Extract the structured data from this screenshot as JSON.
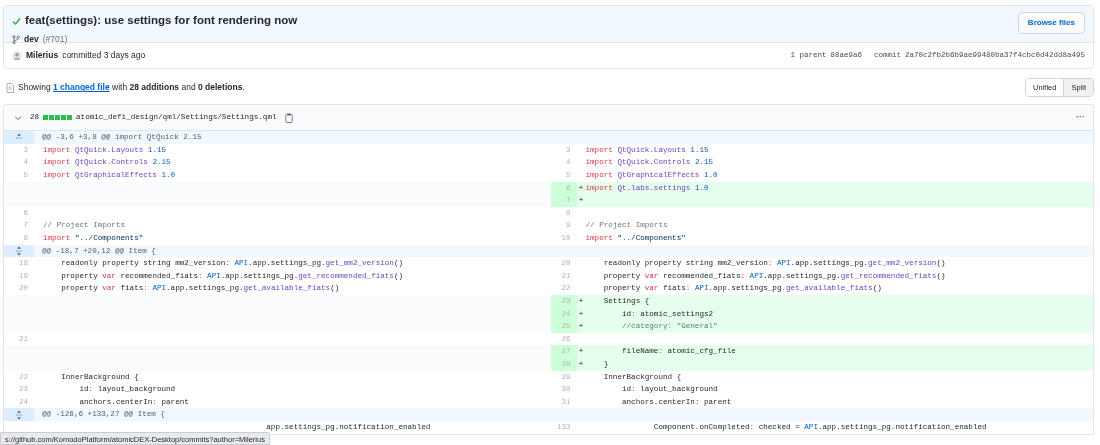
{
  "commit": {
    "title": "feat(settings): use settings for font rendering now",
    "verified": true,
    "branch": "dev",
    "pr": "(#701)",
    "browse_button": "Browse files",
    "author": "Milerius",
    "committed": "committed 3 days ago",
    "parent_label": "1 parent",
    "parent_sha": "88ae9a6",
    "commit_label": "commit",
    "commit_sha": "2a70c2fb2b6b9ae99480ba37f4cbc0d42dd8a495"
  },
  "summary": {
    "before": "Showing",
    "link": "1 changed file",
    "after": "with **28 additions** and **0 deletions**."
  },
  "view_toggle": [
    {
      "label": "Unified",
      "selected": false
    },
    {
      "label": "Split",
      "selected": true
    }
  ],
  "file": {
    "changes": "28",
    "path": "atomic_defi_design/qml/Settings/Settings.qml",
    "more": "···"
  },
  "rows": [
    {
      "kind": "hunk",
      "expand_up": true,
      "expand_down": false,
      "text": "@@ -3,6 +3,8 @@ import QtQuick 2.15"
    },
    {
      "kind": "line",
      "left": {
        "kind": "context",
        "number": "3",
        "tokens": [
          {
            "kind": "keyword",
            "text": "import"
          },
          {
            "kind": "type",
            "text": " QtQuick.Layouts"
          },
          {
            "kind": "number",
            "text": " 1.15"
          }
        ]
      },
      "right": {
        "kind": "context",
        "number": "3",
        "tokens": [
          {
            "kind": "keyword",
            "text": "import"
          },
          {
            "kind": "type",
            "text": " QtQuick.Layouts"
          },
          {
            "kind": "number",
            "text": " 1.15"
          }
        ]
      }
    },
    {
      "kind": "line",
      "left": {
        "kind": "context",
        "number": "4",
        "tokens": [
          {
            "kind": "keyword",
            "text": "import"
          },
          {
            "kind": "type",
            "text": " QtQuick.Controls"
          },
          {
            "kind": "number",
            "text": " 2.15"
          }
        ]
      },
      "right": {
        "kind": "context",
        "number": "4",
        "tokens": [
          {
            "kind": "keyword",
            "text": "import"
          },
          {
            "kind": "type",
            "text": " QtQuick.Controls"
          },
          {
            "kind": "number",
            "text": " 2.15"
          }
        ]
      }
    },
    {
      "kind": "line",
      "left": {
        "kind": "context",
        "number": "5",
        "tokens": [
          {
            "kind": "keyword",
            "text": "import"
          },
          {
            "kind": "type",
            "text": " QtGraphicalEffects"
          },
          {
            "kind": "number",
            "text": " 1.0"
          }
        ]
      },
      "right": {
        "kind": "context",
        "number": "5",
        "tokens": [
          {
            "kind": "keyword",
            "text": "import"
          },
          {
            "kind": "type",
            "text": " QtGraphicalEffects"
          },
          {
            "kind": "number",
            "text": " 1.0"
          }
        ]
      }
    },
    {
      "kind": "line",
      "left": {
        "kind": "empty"
      },
      "right": {
        "kind": "added",
        "number": "6",
        "sign": "+",
        "tokens": [
          {
            "kind": "keyword",
            "text": "import"
          },
          {
            "kind": "type",
            "text": " Qt.labs.settings"
          },
          {
            "kind": "number",
            "text": " 1.0"
          }
        ]
      }
    },
    {
      "kind": "line",
      "left": {
        "kind": "empty"
      },
      "right": {
        "kind": "added",
        "number": "7",
        "sign": "+"
      }
    },
    {
      "kind": "line",
      "left": {
        "kind": "context",
        "number": "6"
      },
      "right": {
        "kind": "context",
        "number": "8"
      }
    },
    {
      "kind": "line",
      "left": {
        "kind": "context",
        "number": "7",
        "tokens": [
          {
            "kind": "comment",
            "text": "// Project Imports"
          }
        ]
      },
      "right": {
        "kind": "context",
        "number": "9",
        "tokens": [
          {
            "kind": "comment",
            "text": "// Project Imports"
          }
        ]
      }
    },
    {
      "kind": "line",
      "left": {
        "kind": "context",
        "number": "8",
        "tokens": [
          {
            "kind": "keyword",
            "text": "import"
          },
          {
            "kind": "string",
            "text": " \"../Components\""
          }
        ]
      },
      "right": {
        "kind": "context",
        "number": "10",
        "tokens": [
          {
            "kind": "keyword",
            "text": "import"
          },
          {
            "kind": "string",
            "text": " \"../Components\""
          }
        ]
      }
    },
    {
      "kind": "hunk",
      "expand_up": true,
      "expand_down": true,
      "text": "@@ -18,7 +20,12 @@ Item {"
    },
    {
      "kind": "line",
      "left": {
        "kind": "context",
        "number": "18",
        "tokens": [
          {
            "kind": "plain",
            "text": "    readonly property string mm2_version"
          },
          {
            "kind": "keyword",
            "text": ":"
          },
          {
            "kind": "number",
            "text": " API"
          },
          {
            "kind": "plain",
            "text": ".app.settings_pg."
          },
          {
            "kind": "type",
            "text": "get_mm2_version"
          },
          {
            "kind": "plain",
            "text": "()"
          }
        ]
      },
      "right": {
        "kind": "context",
        "number": "20",
        "tokens": [
          {
            "kind": "plain",
            "text": "    readonly property string mm2_version"
          },
          {
            "kind": "keyword",
            "text": ":"
          },
          {
            "kind": "number",
            "text": " API"
          },
          {
            "kind": "plain",
            "text": ".app.settings_pg."
          },
          {
            "kind": "type",
            "text": "get_mm2_version"
          },
          {
            "kind": "plain",
            "text": "()"
          }
        ]
      }
    },
    {
      "kind": "line",
      "left": {
        "kind": "context",
        "number": "19",
        "tokens": [
          {
            "kind": "plain",
            "text": "    property "
          },
          {
            "kind": "keyword",
            "text": "var"
          },
          {
            "kind": "plain",
            "text": " recommended_fiats"
          },
          {
            "kind": "keyword",
            "text": ":"
          },
          {
            "kind": "number",
            "text": " API"
          },
          {
            "kind": "plain",
            "text": ".app.settings_pg."
          },
          {
            "kind": "type",
            "text": "get_recommended_fiats"
          },
          {
            "kind": "plain",
            "text": "()"
          }
        ]
      },
      "right": {
        "kind": "context",
        "number": "21",
        "tokens": [
          {
            "kind": "plain",
            "text": "    property "
          },
          {
            "kind": "keyword",
            "text": "var"
          },
          {
            "kind": "plain",
            "text": " recommended_fiats"
          },
          {
            "kind": "keyword",
            "text": ":"
          },
          {
            "kind": "number",
            "text": " API"
          },
          {
            "kind": "plain",
            "text": ".app.settings_pg."
          },
          {
            "kind": "type",
            "text": "get_recommended_fiats"
          },
          {
            "kind": "plain",
            "text": "()"
          }
        ]
      }
    },
    {
      "kind": "line",
      "left": {
        "kind": "context",
        "number": "20",
        "tokens": [
          {
            "kind": "plain",
            "text": "    property "
          },
          {
            "kind": "keyword",
            "text": "var"
          },
          {
            "kind": "plain",
            "text": " fiats"
          },
          {
            "kind": "keyword",
            "text": ":"
          },
          {
            "kind": "number",
            "text": " API"
          },
          {
            "kind": "plain",
            "text": ".app.settings_pg."
          },
          {
            "kind": "type",
            "text": "get_available_fiats"
          },
          {
            "kind": "plain",
            "text": "()"
          }
        ]
      },
      "right": {
        "kind": "context",
        "number": "22",
        "tokens": [
          {
            "kind": "plain",
            "text": "    property "
          },
          {
            "kind": "keyword",
            "text": "var"
          },
          {
            "kind": "plain",
            "text": " fiats"
          },
          {
            "kind": "keyword",
            "text": ":"
          },
          {
            "kind": "number",
            "text": " API"
          },
          {
            "kind": "plain",
            "text": ".app.settings_pg."
          },
          {
            "kind": "type",
            "text": "get_available_fiats"
          },
          {
            "kind": "plain",
            "text": "()"
          }
        ]
      }
    },
    {
      "kind": "line",
      "left": {
        "kind": "empty"
      },
      "right": {
        "kind": "added",
        "number": "23",
        "sign": "+",
        "tokens": [
          {
            "kind": "plain",
            "text": "    Settings {"
          }
        ]
      }
    },
    {
      "kind": "line",
      "left": {
        "kind": "empty"
      },
      "right": {
        "kind": "added",
        "number": "24",
        "sign": "+",
        "tokens": [
          {
            "kind": "plain",
            "text": "        id"
          },
          {
            "kind": "keyword",
            "text": ":"
          },
          {
            "kind": "plain",
            "text": " atomic_settings2"
          }
        ]
      }
    },
    {
      "kind": "line",
      "left": {
        "kind": "empty"
      },
      "right": {
        "kind": "added",
        "number": "25",
        "sign": "+",
        "tokens": [
          {
            "kind": "comment",
            "text": "        //category: \"General\""
          }
        ]
      }
    },
    {
      "kind": "line",
      "left": {
        "kind": "context",
        "number": "21"
      },
      "right": {
        "kind": "context",
        "number": "26"
      }
    },
    {
      "kind": "line",
      "left": {
        "kind": "empty"
      },
      "right": {
        "kind": "added",
        "number": "27",
        "sign": "+",
        "tokens": [
          {
            "kind": "plain",
            "text": "        fileName"
          },
          {
            "kind": "keyword",
            "text": ":"
          },
          {
            "kind": "plain",
            "text": " atomic_cfg_file"
          }
        ]
      }
    },
    {
      "kind": "line",
      "left": {
        "kind": "empty"
      },
      "right": {
        "kind": "added",
        "number": "28",
        "sign": "+",
        "tokens": [
          {
            "kind": "plain",
            "text": "    }"
          }
        ]
      }
    },
    {
      "kind": "line",
      "left": {
        "kind": "context",
        "number": "22",
        "tokens": [
          {
            "kind": "plain",
            "text": "    InnerBackground {"
          }
        ]
      },
      "right": {
        "kind": "context",
        "number": "29",
        "tokens": [
          {
            "kind": "plain",
            "text": "    InnerBackground {"
          }
        ]
      }
    },
    {
      "kind": "line",
      "left": {
        "kind": "context",
        "number": "23",
        "tokens": [
          {
            "kind": "plain",
            "text": "        id"
          },
          {
            "kind": "keyword",
            "text": ":"
          },
          {
            "kind": "plain",
            "text": " layout_background"
          }
        ]
      },
      "right": {
        "kind": "context",
        "number": "30",
        "tokens": [
          {
            "kind": "plain",
            "text": "        id"
          },
          {
            "kind": "keyword",
            "text": ":"
          },
          {
            "kind": "plain",
            "text": " layout_background"
          }
        ]
      }
    },
    {
      "kind": "line",
      "left": {
        "kind": "context",
        "number": "24",
        "tokens": [
          {
            "kind": "plain",
            "text": "        anchors.centerIn"
          },
          {
            "kind": "keyword",
            "text": ":"
          },
          {
            "kind": "plain",
            "text": " parent"
          }
        ]
      },
      "right": {
        "kind": "context",
        "number": "31",
        "tokens": [
          {
            "kind": "plain",
            "text": "        anchors.centerIn"
          },
          {
            "kind": "keyword",
            "text": ":"
          },
          {
            "kind": "plain",
            "text": " parent"
          }
        ]
      }
    },
    {
      "kind": "hunk",
      "expand_up": true,
      "expand_down": true,
      "text": "@@ -126,6 +133,27 @@ Item {"
    },
    {
      "kind": "line",
      "left": {
        "kind": "context",
        "tokens": [
          {
            "kind": "plain",
            "text": "                                                 app.settings_pg.notification_enabled"
          }
        ]
      },
      "right": {
        "kind": "context",
        "number": "133",
        "tokens": [
          {
            "kind": "plain",
            "text": "               Component.onCompleted"
          },
          {
            "kind": "keyword",
            "text": ":"
          },
          {
            "kind": "plain",
            "text": " checked = "
          },
          {
            "kind": "number",
            "text": "API"
          },
          {
            "kind": "plain",
            "text": ".app.settings_pg.notification_enabled"
          }
        ]
      }
    }
  ],
  "status_bar": "s://github.com/KomodoPlatform/atomicDEX-Desktop/commits?author=Milerius"
}
